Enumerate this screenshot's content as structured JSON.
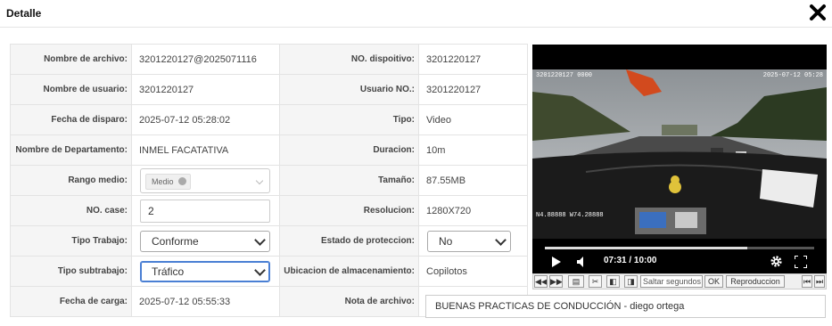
{
  "header": {
    "title": "Detalle",
    "close_icon": "close-icon"
  },
  "left": [
    {
      "label": "Nombre de archivo:",
      "value": "3201220127@2025071116"
    },
    {
      "label": "Nombre de usuario:",
      "value": "3201220127"
    },
    {
      "label": "Fecha de disparo:",
      "value": "2025-07-12 05:28:02"
    },
    {
      "label": "Nombre de Departamento:",
      "value": "INMEL FACATATIVA"
    },
    {
      "label": "Rango medio:",
      "tag": "Medio"
    },
    {
      "label": "NO. case:",
      "input_value": "2"
    },
    {
      "label": "Tipo Trabajo:",
      "select_value": "Conforme"
    },
    {
      "label": "Tipo subtrabajo:",
      "select_value": "Tráfico"
    },
    {
      "label": "Fecha de carga:",
      "value": "2025-07-12 05:55:33"
    }
  ],
  "right": [
    {
      "label": "NO. dispoitivo:",
      "value": "3201220127"
    },
    {
      "label": "Usuario NO.:",
      "value": "3201220127"
    },
    {
      "label": "Tipo:",
      "value": "Video"
    },
    {
      "label": "Duracion:",
      "value": "10m"
    },
    {
      "label": "Tamaño:",
      "value": "87.55MB"
    },
    {
      "label": "Resolucion:",
      "value": "1280X720"
    },
    {
      "label": "Estado de proteccion:",
      "select_value": "No"
    },
    {
      "label": "Ubicacion de almacenamiento:",
      "value": "Copilotos"
    },
    {
      "label": "Nota de archivo:",
      "note": "BUENAS PRACTICAS DE CONDUCCIÓN - diego ortega"
    }
  ],
  "video": {
    "osd_left": "3201220127 0000",
    "osd_right": "2025-07-12 05:28",
    "osd_bottom": "N4.88888 W74.28888",
    "time": "07:31 / 10:00",
    "progress": 0.751
  },
  "toolbar": {
    "skip_placeholder": "Saltar segundos",
    "ok_label": "OK",
    "playback_label": "Reproduccion"
  },
  "colors": {
    "accent": "#4a7fd4",
    "label_bg": "#f5f5f5",
    "border": "#e3e3e3"
  }
}
